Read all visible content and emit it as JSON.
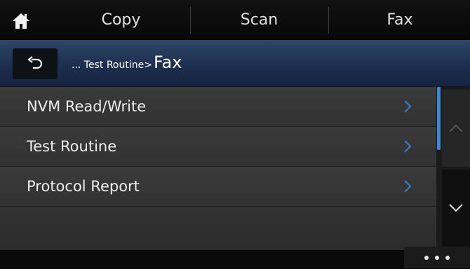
{
  "top_tabs": {
    "home_icon": "home-icon",
    "items": [
      {
        "label": "Copy"
      },
      {
        "label": "Scan"
      },
      {
        "label": "Fax"
      }
    ]
  },
  "title_bar": {
    "back_icon": "back-arrow-icon",
    "breadcrumb_path": "... Test Routine>",
    "current_title": "Fax"
  },
  "menu_list": {
    "items": [
      {
        "label": "NVM Read/Write",
        "icon": "chevron-right-icon"
      },
      {
        "label": "Test Routine",
        "icon": "chevron-right-icon"
      },
      {
        "label": "Protocol Report",
        "icon": "chevron-right-icon"
      }
    ]
  },
  "scroll": {
    "up_icon": "chevron-up-icon",
    "down_icon": "chevron-down-icon",
    "thumb_color": "#3d86d8"
  },
  "bottom_bar": {
    "more_icon": "more-dots-icon"
  },
  "colors": {
    "title_bar": "#1d2f4f",
    "accent": "#3d86d8"
  }
}
